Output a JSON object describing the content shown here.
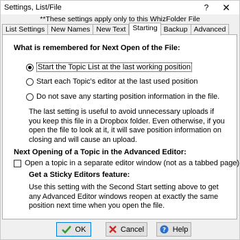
{
  "window": {
    "title": "Settings, List/File",
    "help_glyph": "?",
    "close_glyph": "✕"
  },
  "note": "**These settings apply only to this WhizFolder File",
  "tabs": [
    {
      "label": "List Settings"
    },
    {
      "label": "New Names"
    },
    {
      "label": "New Text"
    },
    {
      "label": "Starting",
      "active": true
    },
    {
      "label": "Backup"
    },
    {
      "label": "Advanced"
    }
  ],
  "section1": {
    "heading": "What is remembered for Next Open of the File:",
    "options": [
      {
        "label": "Start the Topic List at the last working position",
        "selected": true
      },
      {
        "label": "Start each Topic's editor at the last used position",
        "selected": false
      },
      {
        "label": "Do not save any starting position information in the file.",
        "selected": false
      }
    ],
    "description": "The last setting is useful to avoid unnecessary uploads if you keep this file in a Dropbox folder. Even otherwise, if you open the file to look at it, it will save position information on closing and will cause an upload."
  },
  "section2": {
    "heading": "Next Opening of a Topic  in the Advanced Editor:",
    "checkbox_label": "Open a topic in a separate editor window (not as a tabbed page)",
    "checkbox_checked": false,
    "subheading": "Get a Sticky Editors feature:",
    "description": "Use this setting with the Second Start setting above to get any Advanced Editor windows reopen at exactly the same position next time when you open the file."
  },
  "buttons": {
    "ok": "OK",
    "cancel": "Cancel",
    "help": "Help"
  },
  "icons": {
    "ok": "checkmark-icon",
    "cancel": "cross-icon",
    "help": "question-icon"
  },
  "colors": {
    "ok_check": "#2e9e2e",
    "cancel_cross": "#d92323",
    "help_circle": "#2a6fc9"
  }
}
